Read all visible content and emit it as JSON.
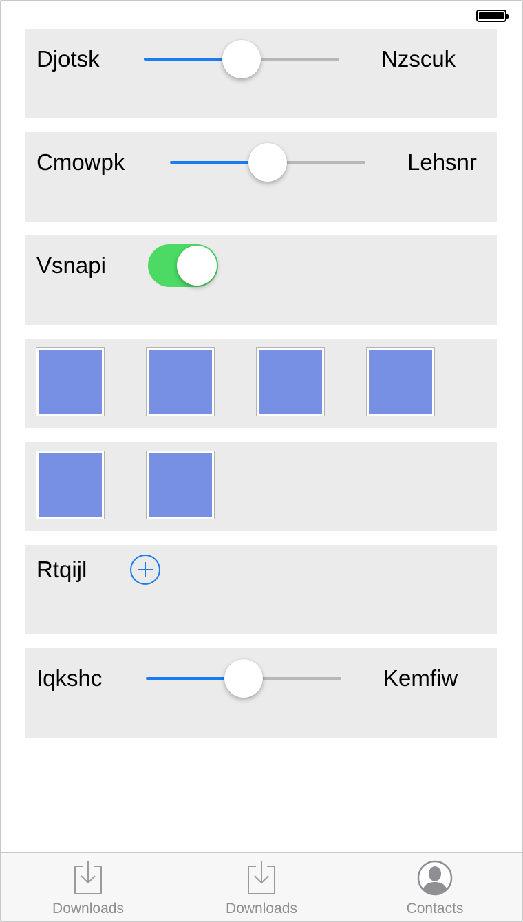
{
  "rows": [
    {
      "type": "slider",
      "min_label": "Djotsk",
      "max_label": "Nzscuk",
      "value": 0.5
    },
    {
      "type": "slider",
      "min_label": "Cmowpk",
      "max_label": "Lehsnr",
      "value": 0.5
    },
    {
      "type": "switch",
      "label": "Vsnapi",
      "on": true
    },
    {
      "type": "swatches",
      "count": 4,
      "color": "#7890e4"
    },
    {
      "type": "swatches",
      "count": 2,
      "color": "#7890e4"
    },
    {
      "type": "stepper",
      "label": "Rtqijl",
      "icon": "plus-circle-icon"
    },
    {
      "type": "slider",
      "min_label": "Iqkshc",
      "max_label": "Kemfiw",
      "value": 0.5
    }
  ],
  "tabbar": {
    "tabs": [
      {
        "label": "Downloads",
        "icon": "downloads-icon"
      },
      {
        "label": "Downloads",
        "icon": "downloads-icon"
      },
      {
        "label": "Contacts",
        "icon": "contacts-icon"
      }
    ]
  },
  "colors": {
    "accent": "#1a7cf0",
    "switch_on": "#4cd964",
    "swatch": "#7890e4",
    "row_bg": "#ebebeb"
  }
}
